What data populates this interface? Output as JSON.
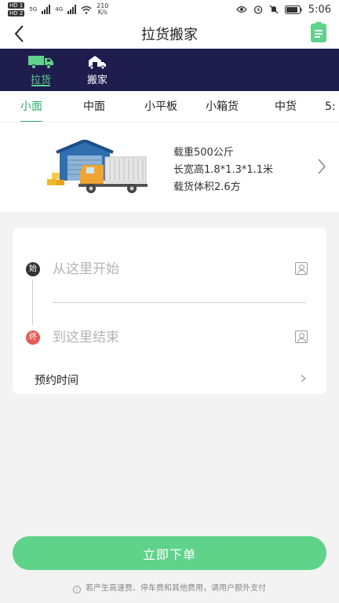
{
  "status_bar": {
    "sim1": "HD 1",
    "sim2": "HD 2",
    "network1": "5G",
    "network2": "4G",
    "speed": "210",
    "speed_unit": "K/s",
    "time": "5:06"
  },
  "header": {
    "title": "拉货搬家",
    "back_icon": "chevron-left-icon",
    "orders_icon": "clipboard-icon"
  },
  "mode_tabs": [
    {
      "label": "拉货",
      "icon": "truck-icon",
      "active": true
    },
    {
      "label": "搬家",
      "icon": "moving-house-icon",
      "active": false
    }
  ],
  "vehicle_tabs": [
    {
      "label": "小面",
      "active": true
    },
    {
      "label": "中面",
      "active": false
    },
    {
      "label": "小平板",
      "active": false
    },
    {
      "label": "小箱货",
      "active": false
    },
    {
      "label": "中货",
      "active": false
    },
    {
      "label": "5:",
      "active": false
    }
  ],
  "vehicle_info": {
    "load": "载重500公斤",
    "dimensions": "长宽高1.8*1.3*1.1米",
    "volume": "载货体积2.6方"
  },
  "address": {
    "start_badge": "始",
    "end_badge": "终",
    "start_placeholder": "从这里开始",
    "end_placeholder": "到这里结束",
    "schedule_label": "预约时间"
  },
  "actions": {
    "submit_label": "立即下单"
  },
  "footer": {
    "note": "若产生高速费、停车费和其他费用，请用户额外支付"
  },
  "colors": {
    "accent": "#5fd38a",
    "active_text": "#2faa67",
    "nav_bg": "#1f1c4e",
    "end_badge": "#e65a55"
  }
}
